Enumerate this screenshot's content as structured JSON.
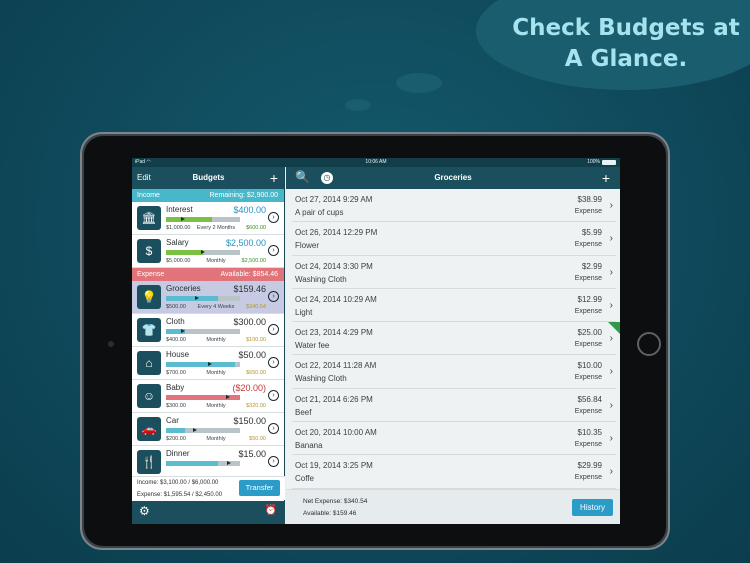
{
  "promo": {
    "headline": "Check Budgets at A Glance."
  },
  "statusbar": {
    "carrier": "iPad",
    "time": "10:06 AM",
    "battery": "100%"
  },
  "colors": {
    "nav": "#1b4f5e",
    "income": "#48b7c9",
    "expense": "#e0747a",
    "accent": "#2a9cc7"
  },
  "left": {
    "edit": "Edit",
    "title": "Budgets",
    "plus": "+",
    "income_header": {
      "label": "Income",
      "remaining": "Remaining: $2,900.00"
    },
    "expense_header": {
      "label": "Expense",
      "available": "Available: $854.46"
    },
    "income_items": [
      {
        "icon": "bank-icon",
        "glyph": "🏛",
        "name": "Interest",
        "amount": "$400.00",
        "color": "blue",
        "progress": 0.62,
        "marker": 0.22,
        "fill": "green",
        "budget": "$1,000.00",
        "freq": "Every 2 Months",
        "accum": "$600.00",
        "acc_color": "green"
      },
      {
        "icon": "money-bag-icon",
        "glyph": "$",
        "name": "Salary",
        "amount": "$2,500.00",
        "color": "blue",
        "progress": 0.5,
        "marker": 0.5,
        "fill": "green",
        "budget": "$5,000.00",
        "freq": "Monthly",
        "accum": "$2,500.00",
        "acc_color": "green"
      }
    ],
    "expense_items": [
      {
        "icon": "lightbulb-icon",
        "glyph": "💡",
        "name": "Groceries",
        "amount": "$159.46",
        "color": "dark",
        "progress": 0.7,
        "marker": 0.42,
        "fill": "blue",
        "budget": "$500.00",
        "freq": "Every 4 Weeks",
        "accum": "$340.54",
        "acc_color": "gold",
        "selected": true
      },
      {
        "icon": "shirt-icon",
        "glyph": "👕",
        "name": "Cloth",
        "amount": "$300.00",
        "color": "dark",
        "progress": 0.25,
        "marker": 0.22,
        "fill": "blue",
        "budget": "$400.00",
        "freq": "Monthly",
        "accum": "$100.00",
        "acc_color": "gold"
      },
      {
        "icon": "house-icon",
        "glyph": "⌂",
        "name": "House",
        "amount": "$50.00",
        "color": "dark",
        "progress": 0.93,
        "marker": 0.6,
        "fill": "blue",
        "budget": "$700.00",
        "freq": "Monthly",
        "accum": "$650.00",
        "acc_color": "gold"
      },
      {
        "icon": "baby-icon",
        "glyph": "☺",
        "name": "Baby",
        "amount": "($20.00)",
        "color": "red",
        "progress": 1.0,
        "marker": 0.85,
        "fill": "red",
        "budget": "$300.00",
        "freq": "Monthly",
        "accum": "$320.00",
        "acc_color": "gold"
      },
      {
        "icon": "car-icon",
        "glyph": "🚗",
        "name": "Car",
        "amount": "$150.00",
        "color": "dark",
        "progress": 0.25,
        "marker": 0.38,
        "fill": "blue",
        "budget": "$200.00",
        "freq": "Monthly",
        "accum": "$50.00",
        "acc_color": "gold"
      },
      {
        "icon": "utensils-icon",
        "glyph": "🍴",
        "name": "Dinner",
        "amount": "$15.00",
        "color": "dark",
        "progress": 0.7,
        "marker": 0.87,
        "fill": "blue",
        "budget": "",
        "freq": "",
        "accum": "",
        "acc_color": "gold"
      }
    ],
    "footer": {
      "income_line": "Income: $3,100.00 / $6,000.00",
      "expense_line": "Expense: $1,595.54 / $2,450.00",
      "transfer": "Transfer"
    }
  },
  "right": {
    "title": "Groceries",
    "plus": "+",
    "transactions": [
      {
        "date": "Oct 27, 2014 9:29 AM",
        "note": "A pair of cups",
        "amount": "$38.99",
        "type": "Expense"
      },
      {
        "date": "Oct 26, 2014 12:29 PM",
        "note": "Flower",
        "amount": "$5.99",
        "type": "Expense"
      },
      {
        "date": "Oct 24, 2014 3:30 PM",
        "note": "Washing Cloth",
        "amount": "$2.99",
        "type": "Expense"
      },
      {
        "date": "Oct 24, 2014 10:29 AM",
        "note": "Light",
        "amount": "$12.99",
        "type": "Expense"
      },
      {
        "date": "Oct 23, 2014 4:29 PM",
        "note": "Water fee",
        "amount": "$25.00",
        "type": "Expense",
        "flag": true
      },
      {
        "date": "Oct 22, 2014 11:28 AM",
        "note": "Washing Cloth",
        "amount": "$10.00",
        "type": "Expense"
      },
      {
        "date": "Oct 21, 2014 6:26 PM",
        "note": "Beef",
        "amount": "$56.84",
        "type": "Expense"
      },
      {
        "date": "Oct 20, 2014 10:00 AM",
        "note": "Banana",
        "amount": "$10.35",
        "type": "Expense"
      },
      {
        "date": "Oct 19, 2014 3:25 PM",
        "note": "Coffe",
        "amount": "$29.99",
        "type": "Expense"
      }
    ],
    "footer": {
      "net_expense": "Net Expense: $340.54",
      "available": "Available: $159.46",
      "history": "History"
    }
  }
}
